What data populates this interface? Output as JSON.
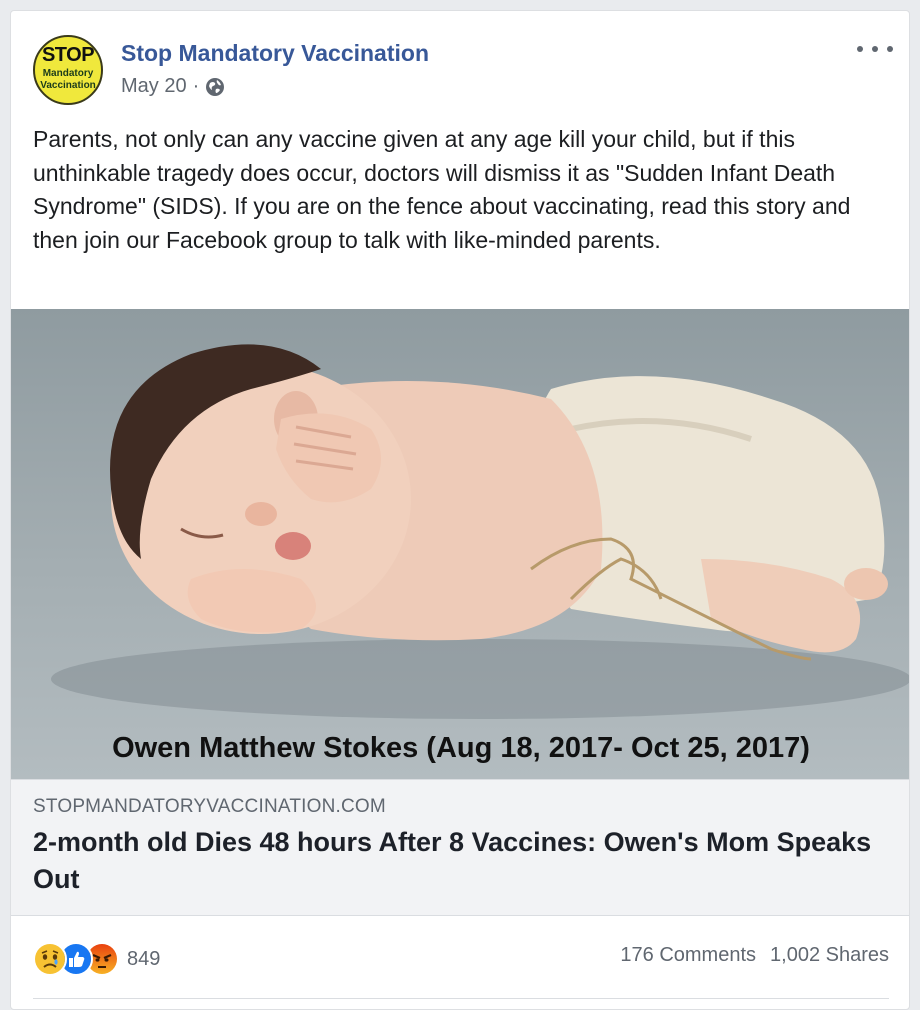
{
  "post": {
    "page_name": "Stop Mandatory Vaccination",
    "date": "May 20",
    "dot": "·",
    "privacy_icon": "globe-icon",
    "more_icon": "more-options-icon",
    "avatar": {
      "line1": "STOP",
      "line2": "Mandatory",
      "line3": "Vaccination",
      "bg_color": "#f0e83c"
    },
    "text": "Parents, not only can any vaccine given at any age kill your child, but if this unthinkable tragedy does occur, doctors will dismiss it as \"Sudden Infant Death Syndrome\" (SIDS). If you are on the fence about vaccinating, read this story and then join our Facebook group to talk with like-minded parents."
  },
  "media": {
    "caption": "Owen Matthew Stokes (Aug 18, 2017- Oct 25, 2017)"
  },
  "link": {
    "domain": "STOPMANDATORYVACCINATION.COM",
    "headline": "2-month old Dies 48 hours After 8 Vaccines: Owen's Mom Speaks Out"
  },
  "footer": {
    "reaction_icons": [
      "sad-reaction-icon",
      "like-reaction-icon",
      "angry-reaction-icon"
    ],
    "reaction_count": "849",
    "comments": "176 Comments",
    "shares": "1,002 Shares"
  },
  "colors": {
    "page_name": "#385898",
    "meta_text": "#606770",
    "like_blue": "#1877f2",
    "angry_red": "#e9710f"
  }
}
